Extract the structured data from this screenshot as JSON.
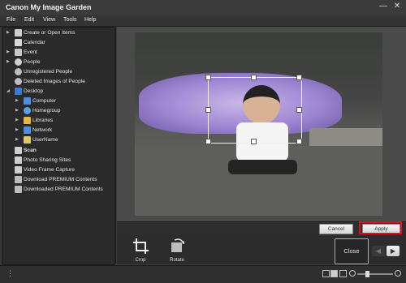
{
  "window": {
    "title": "Canon My Image Garden",
    "minimize_icon": "—",
    "close_icon": "✕"
  },
  "menu": [
    "File",
    "Edit",
    "View",
    "Tools",
    "Help"
  ],
  "sidebar": {
    "items": [
      {
        "label": "Create or Open Items",
        "arrow": "▶",
        "icon": "create-items-icon",
        "color": "#cfcfcf"
      },
      {
        "label": "Calendar",
        "arrow": "",
        "icon": "calendar-icon",
        "color": "#d8d8d8"
      },
      {
        "label": "Event",
        "arrow": "▶",
        "icon": "event-icon",
        "color": "#c8c8c8"
      },
      {
        "label": "People",
        "arrow": "▶",
        "icon": "people-icon",
        "color": "#cfcfcf"
      },
      {
        "label": "Unregistered People",
        "arrow": "",
        "icon": "unregistered-people-icon",
        "color": "#bdbdbd"
      },
      {
        "label": "Deleted Images of People",
        "arrow": "",
        "icon": "deleted-people-icon",
        "color": "#bdbdbd"
      },
      {
        "label": "Desktop",
        "arrow": "◢",
        "icon": "desktop-icon",
        "color": "#3a7bd5"
      },
      {
        "label": "Computer",
        "arrow": "▶",
        "icon": "computer-icon",
        "color": "#4a90e2"
      },
      {
        "label": "Homegroup",
        "arrow": "▶",
        "icon": "homegroup-icon",
        "color": "#5aa1e8"
      },
      {
        "label": "Libraries",
        "arrow": "▶",
        "icon": "libraries-icon",
        "color": "#e0b84a"
      },
      {
        "label": "Network",
        "arrow": "▶",
        "icon": "network-icon",
        "color": "#4a90e2"
      },
      {
        "label": "UserName",
        "arrow": "▶",
        "icon": "user-folder-icon",
        "color": "#e3c56a"
      },
      {
        "label": "Scan",
        "arrow": "",
        "icon": "scan-icon",
        "color": "#cfcfcf",
        "bold": true
      },
      {
        "label": "Photo Sharing Sites",
        "arrow": "",
        "icon": "photo-sharing-icon",
        "color": "#cfcfcf"
      },
      {
        "label": "Video Frame Capture",
        "arrow": "",
        "icon": "video-capture-icon",
        "color": "#cfcfcf"
      },
      {
        "label": "Download PREMIUM Contents",
        "arrow": "",
        "icon": "download-premium-icon",
        "color": "#bdbdbd"
      },
      {
        "label": "Downloaded PREMIUM Contents",
        "arrow": "",
        "icon": "downloaded-premium-icon",
        "color": "#bdbdbd"
      }
    ]
  },
  "edit_bar": {
    "cancel_label": "Cancel",
    "apply_label": "Apply"
  },
  "tools": {
    "crop_label": "Crop",
    "rotate_label": "Rotate",
    "close_label": "Close"
  },
  "nav": {
    "prev_icon": "◀",
    "next_icon": "▶"
  },
  "status": {
    "left_icon": "⋮"
  }
}
